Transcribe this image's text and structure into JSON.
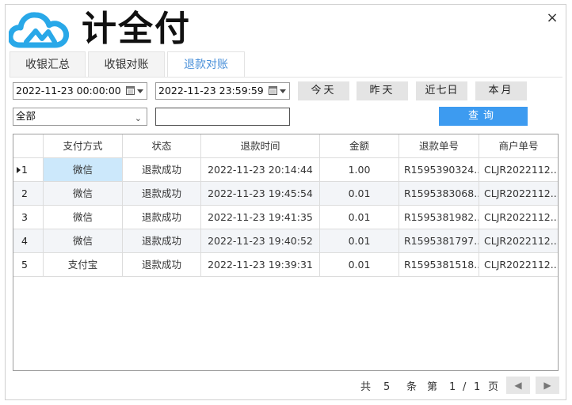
{
  "app": {
    "logo_text": "计全付"
  },
  "window": {
    "close_glyph": "×"
  },
  "tabs": [
    {
      "label": "收银汇总"
    },
    {
      "label": "收银对账"
    },
    {
      "label": "退款对账"
    }
  ],
  "filters": {
    "start_time": "2022-11-23 00:00:00",
    "end_time": "2022-11-23 23:59:59",
    "pay_method": "全部",
    "search_value": "",
    "buttons": {
      "today": "今天",
      "yesterday": "昨天",
      "last7": "近七日",
      "month": "本月",
      "query": "查询"
    }
  },
  "table": {
    "columns": [
      "支付方式",
      "状态",
      "退款时间",
      "金额",
      "退款单号",
      "商户单号"
    ],
    "rows": [
      {
        "idx": "1",
        "pay": "微信",
        "status": "退款成功",
        "time": "2022-11-23 20:14:44",
        "amount": "1.00",
        "refund_no": "R1595390324...",
        "merchant_no": "CLJR2022112..."
      },
      {
        "idx": "2",
        "pay": "微信",
        "status": "退款成功",
        "time": "2022-11-23 19:45:54",
        "amount": "0.01",
        "refund_no": "R1595383068...",
        "merchant_no": "CLJR2022112..."
      },
      {
        "idx": "3",
        "pay": "微信",
        "status": "退款成功",
        "time": "2022-11-23 19:41:35",
        "amount": "0.01",
        "refund_no": "R1595381982...",
        "merchant_no": "CLJR2022112..."
      },
      {
        "idx": "4",
        "pay": "微信",
        "status": "退款成功",
        "time": "2022-11-23 19:40:52",
        "amount": "0.01",
        "refund_no": "R1595381797...",
        "merchant_no": "CLJR2022112..."
      },
      {
        "idx": "5",
        "pay": "支付宝",
        "status": "退款成功",
        "time": "2022-11-23 19:39:31",
        "amount": "0.01",
        "refund_no": "R1595381518...",
        "merchant_no": "CLJR2022112..."
      }
    ]
  },
  "pager": {
    "total_prefix": "共",
    "total": "5",
    "total_unit": "条",
    "page_prefix": "第",
    "page_current": "1",
    "page_sep": "/",
    "page_total": "1",
    "page_unit": "页",
    "prev_glyph": "◀",
    "next_glyph": "▶"
  },
  "colors": {
    "accent": "#3d9bf0",
    "selected_cell": "#cce8fb",
    "logo_blue": "#29a8e8"
  }
}
